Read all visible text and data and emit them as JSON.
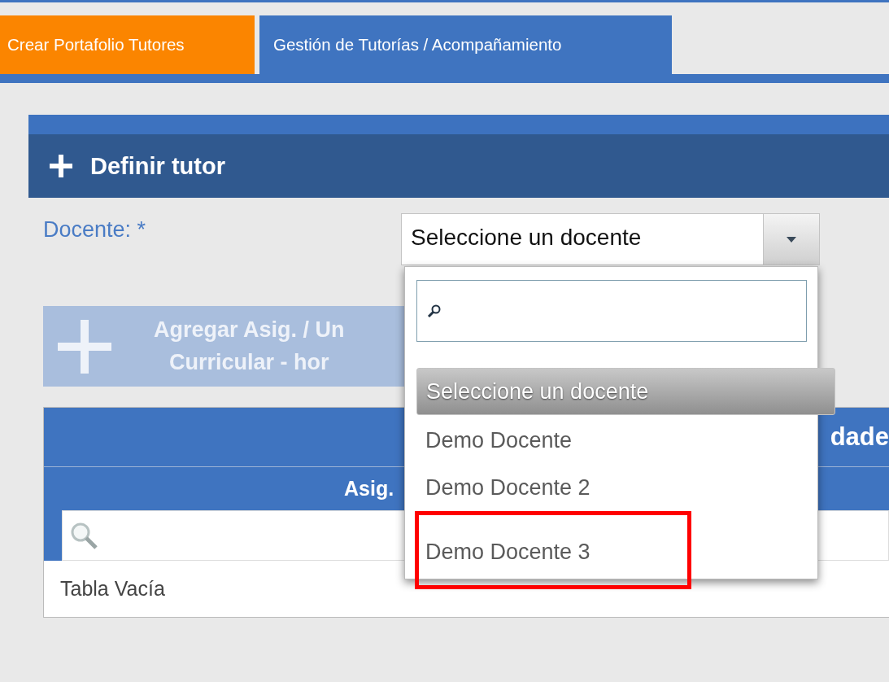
{
  "tabs": [
    {
      "label": "Crear Portafolio Tutores",
      "selected": false
    },
    {
      "label": "Gestión de Tutorías / Acompañamiento",
      "selected": true
    }
  ],
  "panel": {
    "title": "Definir tutor",
    "field_label": "Docente: *",
    "select": {
      "value": "Seleccione un docente",
      "expanded": true
    },
    "add_button": {
      "label": "Agregar Asig. / Un\nCurricular - hor",
      "disabled": true
    }
  },
  "dropdown": {
    "options": [
      {
        "label": "Seleccione un docente",
        "selected": true,
        "highlighted": false
      },
      {
        "label": "Demo Docente",
        "selected": false,
        "highlighted": false
      },
      {
        "label": "Demo Docente 2",
        "selected": false,
        "highlighted": false
      },
      {
        "label": "Demo Docente 3",
        "selected": false,
        "highlighted": true
      }
    ]
  },
  "table": {
    "title": "dade",
    "columns": [
      "Asig."
    ],
    "empty_text": "Tabla Vacía"
  }
}
